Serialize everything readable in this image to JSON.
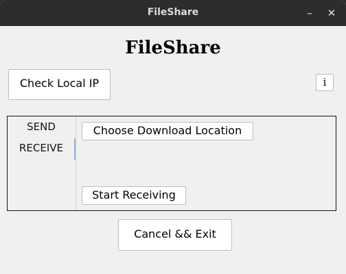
{
  "window": {
    "title": "FileShare",
    "minimize_glyph": "–",
    "close_glyph": "✕"
  },
  "app": {
    "heading": "FileShare"
  },
  "top_buttons": {
    "check_ip_label": "Check Local IP",
    "info_label": "i"
  },
  "tabs": [
    {
      "label": "SEND",
      "selected": false
    },
    {
      "label": "RECEIVE",
      "selected": true
    }
  ],
  "receive_panel": {
    "choose_location_label": "Choose Download Location",
    "start_receiving_label": "Start Receiving"
  },
  "footer": {
    "cancel_exit_label": "Cancel && Exit"
  },
  "colors": {
    "titlebar_bg": "#2d2d2d",
    "window_bg": "#f0f0f0",
    "tab_indicator": "#8ab2e6"
  }
}
